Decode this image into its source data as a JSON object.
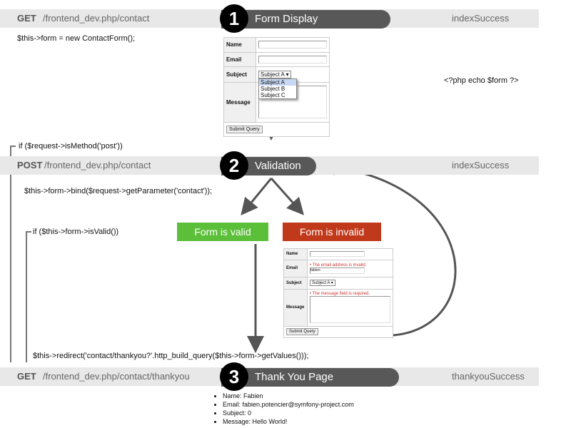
{
  "steps": [
    {
      "number": "1",
      "title": "Form Display",
      "method": "GET",
      "url": "/frontend_dev.php/contact",
      "action": "indexSuccess"
    },
    {
      "number": "2",
      "title": "Validation",
      "method": "POST",
      "url": "/frontend_dev.php/contact",
      "action": "indexSuccess"
    },
    {
      "number": "3",
      "title": "Thank You Page",
      "method": "GET",
      "url": "/frontend_dev.php/contact/thankyou",
      "action": "thankyouSuccess"
    }
  ],
  "code": {
    "new_form": "$this->form = new ContactForm();",
    "echo_form": "<?php echo $form ?>",
    "is_post": "if ($request->isMethod('post'))",
    "bind": "$this->form->bind($request->getParameter('contact'));",
    "is_valid": "if ($this->form->isValid())",
    "redirect": "$this->redirect('contact/thankyou?'.http_build_query($this->form->getValues()));"
  },
  "outcomes": {
    "valid": "Form is valid",
    "invalid": "Form is invalid",
    "valid_color": "#5cbf3a",
    "invalid_color": "#c0391b"
  },
  "form": {
    "labels": {
      "name": "Name",
      "email": "Email",
      "subject": "Subject",
      "message": "Message"
    },
    "subject_value": "Subject A",
    "subject_options": [
      "Subject A",
      "Subject B",
      "Subject C"
    ],
    "submit": "Submit Query",
    "email_value": "fabien",
    "email_error": "The email address is invalid.",
    "message_error": "The message field is required."
  },
  "thankyou": [
    "Name: Fabien",
    "Email: fabien.potencier@symfony-project.com",
    "Subject: 0",
    "Message: Hello World!"
  ]
}
